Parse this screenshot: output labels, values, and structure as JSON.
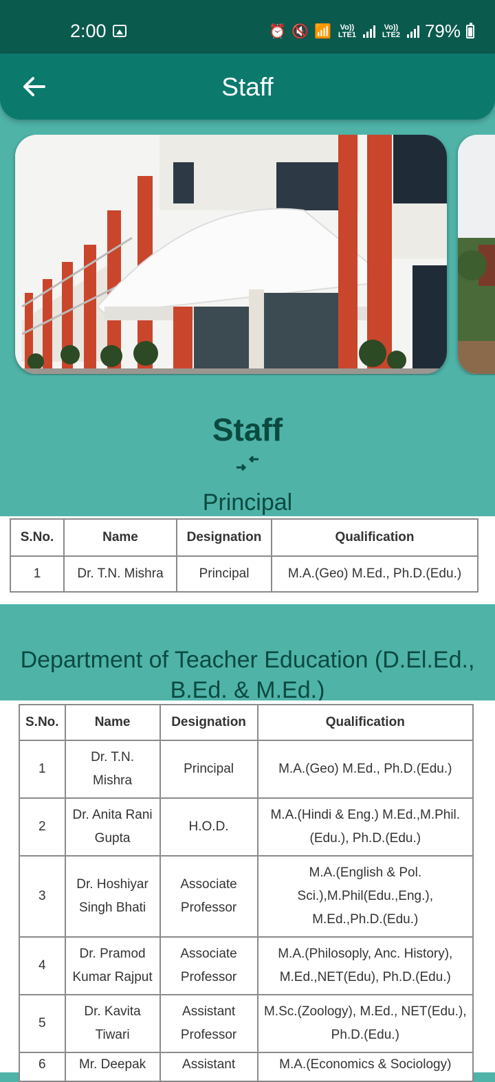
{
  "status_bar": {
    "time": "2:00",
    "battery": "79%",
    "sim1_label": "Vo)) LTE1",
    "sim2_label": "Vo)) LTE2"
  },
  "app_bar": {
    "title": "Staff"
  },
  "content": {
    "heading": "Staff",
    "principal_heading": "Principal",
    "dept_heading": "Department of Teacher Education (D.El.Ed., B.Ed. & M.Ed.)"
  },
  "principal_table": {
    "headers": [
      "S.No.",
      "Name",
      "Designation",
      "Qualification"
    ],
    "rows": [
      [
        "1",
        "Dr. T.N. Mishra",
        "Principal",
        "M.A.(Geo) M.Ed., Ph.D.(Edu.)"
      ]
    ]
  },
  "dept_table": {
    "headers": [
      "S.No.",
      "Name",
      "Designation",
      "Qualification"
    ],
    "rows": [
      [
        "1",
        "Dr. T.N. Mishra",
        "Principal",
        "M.A.(Geo) M.Ed., Ph.D.(Edu.)"
      ],
      [
        "2",
        "Dr. Anita Rani Gupta",
        "H.O.D.",
        "M.A.(Hindi & Eng.) M.Ed.,M.Phil.(Edu.), Ph.D.(Edu.)"
      ],
      [
        "3",
        "Dr. Hoshiyar Singh Bhati",
        "Associate Professor",
        "M.A.(English & Pol. Sci.),M.Phil(Edu.,Eng.), M.Ed.,Ph.D.(Edu.)"
      ],
      [
        "4",
        "Dr. Pramod Kumar Rajput",
        "Associate Professor",
        "M.A.(Philosoply, Anc. History), M.Ed.,NET(Edu), Ph.D.(Edu.)"
      ],
      [
        "5",
        "Dr. Kavita Tiwari",
        "Assistant Professor",
        "M.Sc.(Zoology), M.Ed., NET(Edu.), Ph.D.(Edu.)"
      ],
      [
        "6",
        "Mr. Deepak",
        "Assistant",
        "M.A.(Economics & Sociology)"
      ]
    ]
  },
  "colors": {
    "status_bar": "#0b5a4e",
    "app_bar": "#0b7a6d",
    "background": "#4fb3a8",
    "heading_text": "#0b4a40"
  }
}
